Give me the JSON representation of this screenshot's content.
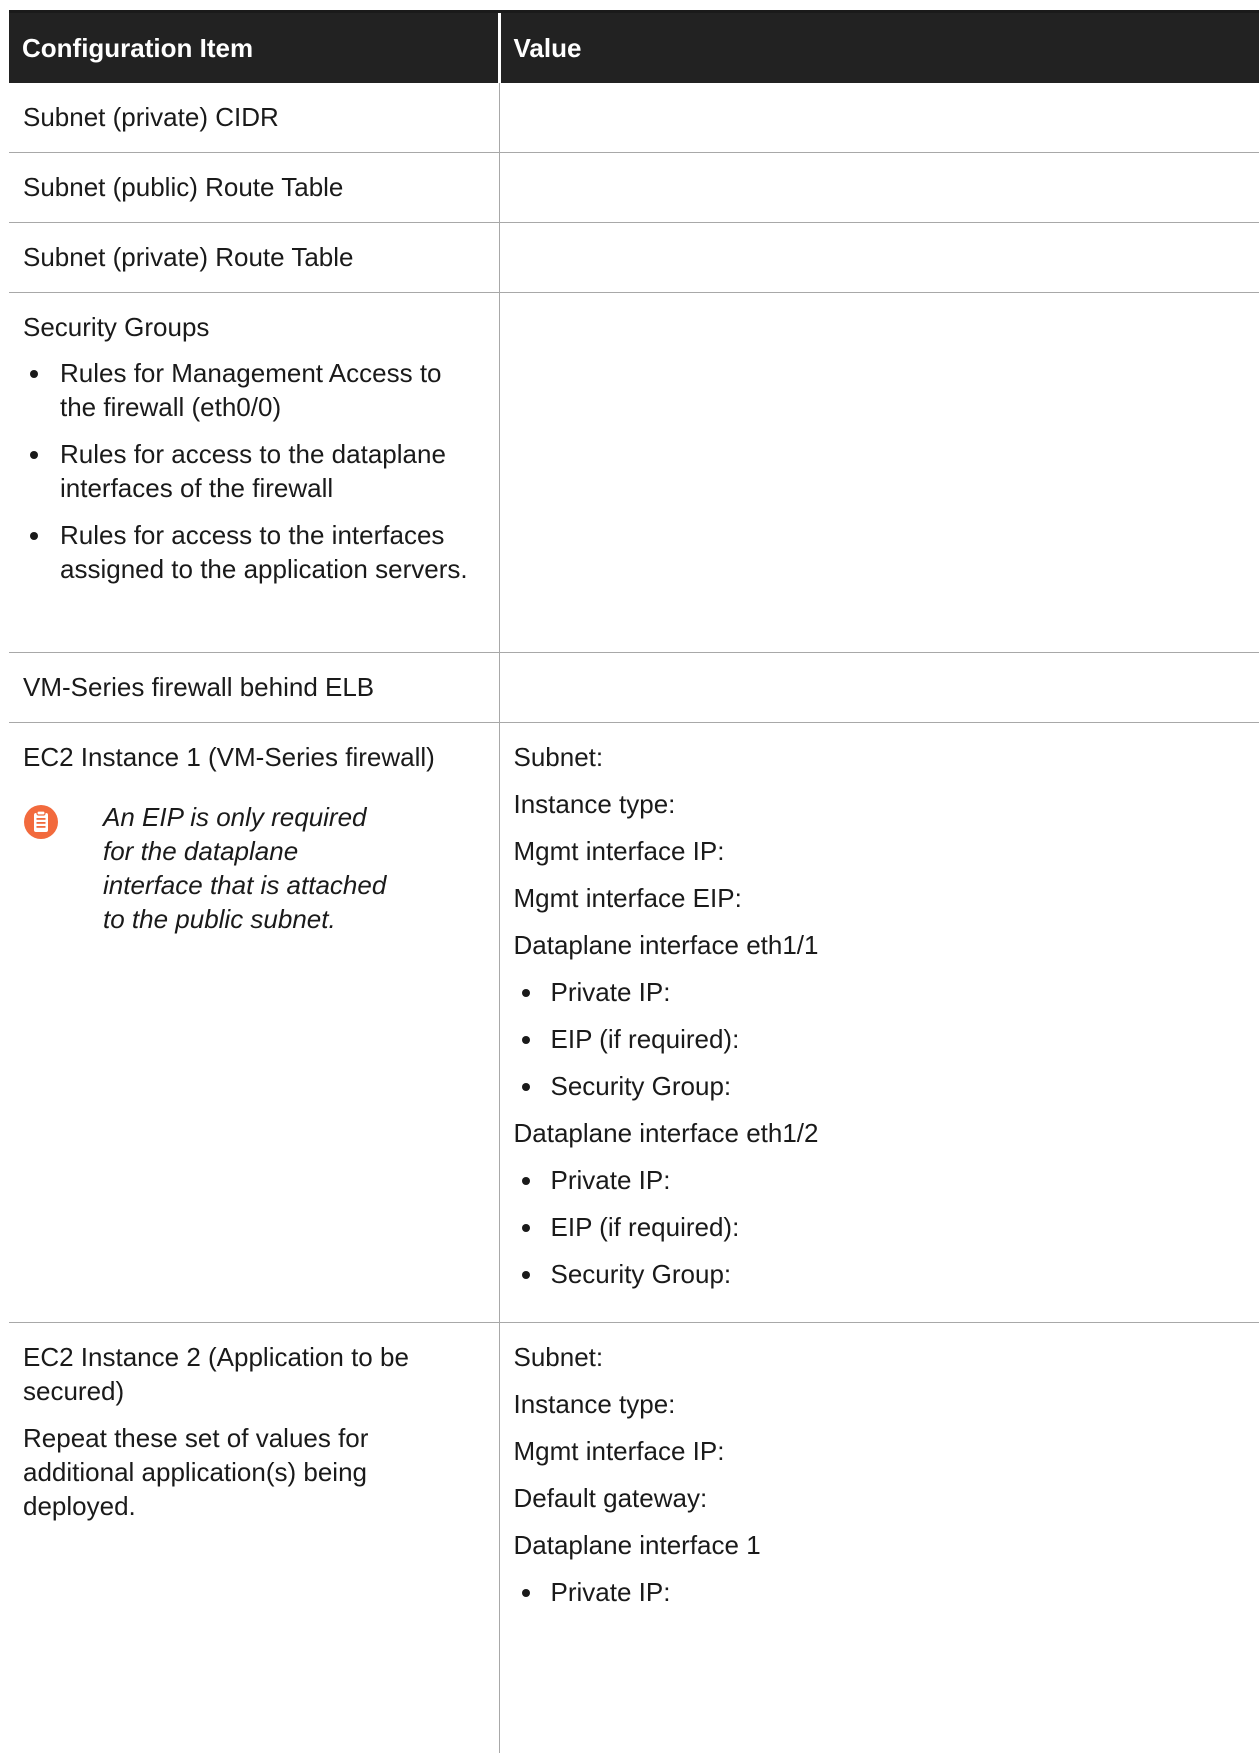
{
  "table": {
    "header": {
      "col1": "Configuration Item",
      "col2": "Value"
    },
    "rows": {
      "subnet_private_cidr": {
        "item": "Subnet (private) CIDR"
      },
      "subnet_public_route": {
        "item": "Subnet (public) Route Table"
      },
      "subnet_private_route": {
        "item": "Subnet (private) Route Table"
      },
      "security_groups": {
        "item": "Security Groups",
        "bullets": [
          "Rules for Management Access to the firewall (eth0/0)",
          "Rules for access to the dataplane interfaces of the firewall",
          "Rules for access to the interfaces assigned to the application servers."
        ]
      },
      "vm_elb": {
        "item": "VM-Series firewall behind ELB"
      },
      "ec2_1": {
        "item": "EC2 Instance 1 (VM-Series firewall)",
        "note": "An EIP is only required for the dataplane interface that is attached to the public subnet.",
        "note_icon": "note-clipboard-icon",
        "note_color": "#f26a3d",
        "values": {
          "subnet": "Subnet:",
          "instance_type": "Instance type:",
          "mgmt_ip": "Mgmt interface IP:",
          "mgmt_eip": "Mgmt interface EIP:",
          "dp1_title": "Dataplane interface eth1/1",
          "dp1_items": [
            "Private IP:",
            "EIP (if required):",
            "Security Group:"
          ],
          "dp2_title": "Dataplane interface eth1/2",
          "dp2_items": [
            "Private IP:",
            "EIP (if required):",
            "Security Group:"
          ]
        }
      },
      "ec2_2": {
        "item": "EC2 Instance 2 (Application to be secured)",
        "item_note": "Repeat these set of values for additional application(s) being deployed.",
        "values": {
          "subnet": "Subnet:",
          "instance_type": "Instance type:",
          "mgmt_ip": "Mgmt interface IP:",
          "default_gw": "Default gateway:",
          "dp_title": "Dataplane interface 1",
          "dp_items": [
            "Private IP:"
          ]
        }
      }
    }
  }
}
